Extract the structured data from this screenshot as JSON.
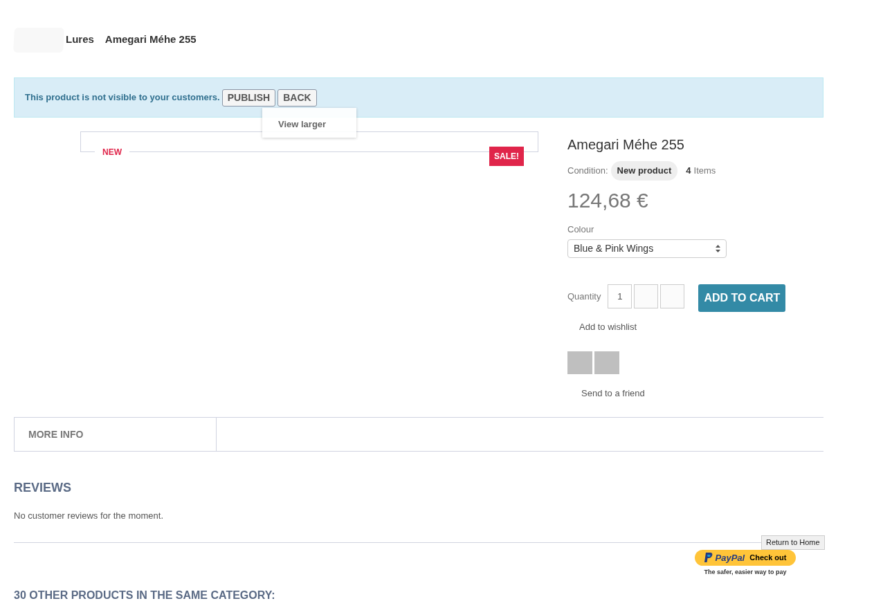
{
  "breadcrumb": {
    "items": [
      "Lures",
      "Amegari Méhe 255"
    ]
  },
  "alert": {
    "message": "This product is not visible to your customers.",
    "buttons": [
      "PUBLISH",
      "BACK"
    ]
  },
  "image": {
    "hover_link": "View larger",
    "new_label": "NEW",
    "sale_badge": "SALE!"
  },
  "product": {
    "title": "Amegari Méhe 255",
    "condition_label": "Condition:",
    "condition": "New product",
    "quantity_count": "4",
    "quantity_unit": "Items",
    "price": "124,68 €",
    "colour_label": "Colour",
    "colour_value": "Blue & Pink Wings",
    "quantity_label": "Quantity",
    "quantity_value": "1",
    "add_to_cart": "ADD TO CART",
    "wishlist": "Add to wishlist",
    "send_to_friend": "Send to a friend"
  },
  "tabs": [
    {
      "label": "MORE INFO",
      "selected": true
    }
  ],
  "reviews": {
    "heading": "REVIEWS",
    "message": "No customer reviews for the moment."
  },
  "paypal": {
    "brand": "PayPal",
    "button": "Check out",
    "tagline": "The safer, easier way to pay"
  },
  "tooltip": "Return to Home",
  "related_heading": "30 OTHER PRODUCTS IN THE SAME CATEGORY:"
}
